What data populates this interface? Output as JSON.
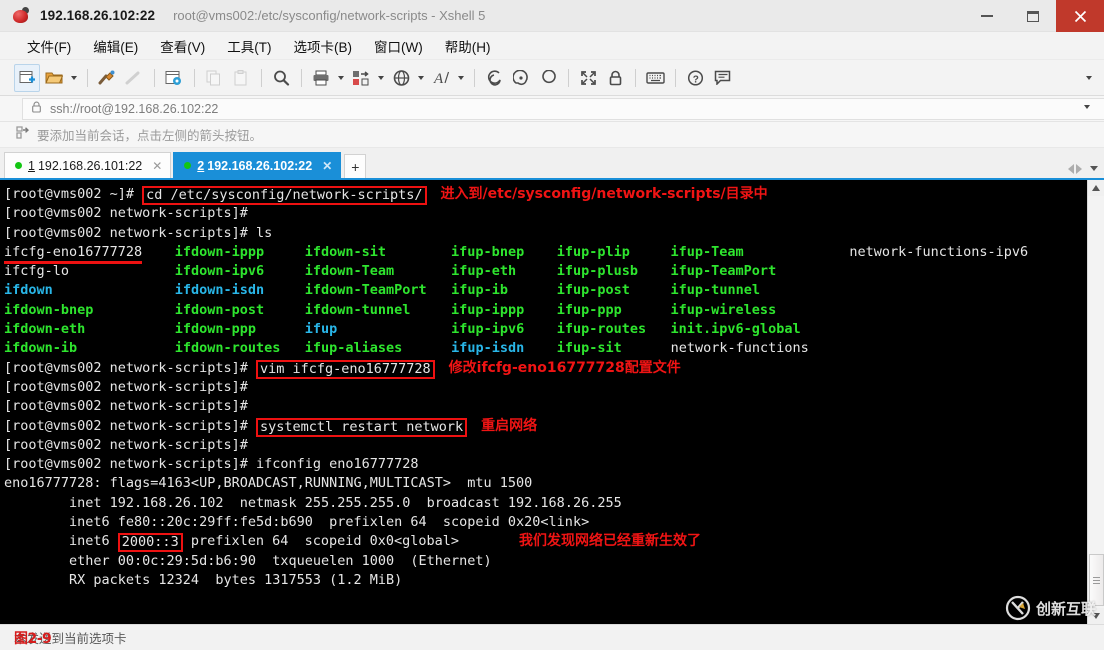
{
  "window": {
    "address_title": "192.168.26.102:22",
    "subtitle": "root@vms002:/etc/sysconfig/network-scripts - Xshell 5",
    "app_icon": "xshell-logo-icon",
    "controls": {
      "minimize": "minimize-button",
      "maximize": "maximize-button",
      "close": "close-button"
    }
  },
  "menubar": {
    "items": [
      {
        "label": "文件(F)",
        "name": "menu-file"
      },
      {
        "label": "编辑(E)",
        "name": "menu-edit"
      },
      {
        "label": "查看(V)",
        "name": "menu-view"
      },
      {
        "label": "工具(T)",
        "name": "menu-tools"
      },
      {
        "label": "选项卡(B)",
        "name": "menu-tab"
      },
      {
        "label": "窗口(W)",
        "name": "menu-window"
      },
      {
        "label": "帮助(H)",
        "name": "menu-help"
      }
    ]
  },
  "toolbar": {
    "buttons": [
      "new-session-icon",
      "open-folder-icon",
      "folder-dropdown-caret",
      "connect-icon",
      "disconnect-icon",
      "session-properties-icon",
      "copy-icon",
      "paste-icon",
      "find-icon",
      "print-icon",
      "print-dropdown-caret",
      "transfer-file-icon",
      "transfer-dropdown-caret",
      "web-browser-icon",
      "web-dropdown-caret",
      "font-icon",
      "font-dropdown-caret",
      "ftp-icon",
      "tunnel-icon",
      "compose-icon",
      "fullscreen-icon",
      "lock-icon",
      "keyboard-icon",
      "help-icon",
      "feedback-icon"
    ],
    "overflow": "toolbar-overflow-caret"
  },
  "addressbar": {
    "lock_icon": "lock-icon",
    "value": "ssh://root@192.168.26.102:22",
    "placeholder": "ssh://",
    "dropdown": "address-dropdown-caret"
  },
  "hintbar": {
    "icon": "add-session-arrow-icon",
    "text": "要添加当前会话，点击左侧的箭头按钮。"
  },
  "tabs": {
    "items": [
      {
        "num": "1",
        "label": "192.168.26.101:22",
        "active": false,
        "status": "connected"
      },
      {
        "num": "2",
        "label": "192.168.26.102:22",
        "active": true,
        "status": "connected"
      }
    ],
    "add_label": "+",
    "nav": {
      "prev": "tab-prev-arrow",
      "next": "tab-next-arrow",
      "list": "tab-list-caret"
    }
  },
  "terminal": {
    "prompt_home": "[root@vms002 ~]# ",
    "prompt_dir": "[root@vms002 network-scripts]# ",
    "cmd_cd": "cd /etc/sysconfig/network-scripts/",
    "cmd_ls": "ls",
    "cmd_vim": "vim ifcfg-eno16777728",
    "cmd_systemctl": "systemctl restart network",
    "cmd_ifconfig": "ifconfig eno16777728",
    "ls_rows": [
      [
        {
          "t": "ifcfg-eno16777728",
          "c": "wht"
        },
        {
          "t": "ifdown-ippp",
          "c": "grn"
        },
        {
          "t": "ifdown-sit",
          "c": "grn"
        },
        {
          "t": "ifup-bnep",
          "c": "grn"
        },
        {
          "t": "ifup-plip",
          "c": "grn"
        },
        {
          "t": "ifup-Team",
          "c": "grn"
        },
        {
          "t": "network-functions-ipv6",
          "c": "wht"
        }
      ],
      [
        {
          "t": "ifcfg-lo",
          "c": "wht"
        },
        {
          "t": "ifdown-ipv6",
          "c": "grn"
        },
        {
          "t": "ifdown-Team",
          "c": "grn"
        },
        {
          "t": "ifup-eth",
          "c": "grn"
        },
        {
          "t": "ifup-plusb",
          "c": "grn"
        },
        {
          "t": "ifup-TeamPort",
          "c": "grn"
        },
        {
          "t": "",
          "c": "wht"
        }
      ],
      [
        {
          "t": "ifdown",
          "c": "cyn"
        },
        {
          "t": "ifdown-isdn",
          "c": "cyn"
        },
        {
          "t": "ifdown-TeamPort",
          "c": "grn"
        },
        {
          "t": "ifup-ib",
          "c": "grn"
        },
        {
          "t": "ifup-post",
          "c": "grn"
        },
        {
          "t": "ifup-tunnel",
          "c": "grn"
        },
        {
          "t": "",
          "c": "wht"
        }
      ],
      [
        {
          "t": "ifdown-bnep",
          "c": "grn"
        },
        {
          "t": "ifdown-post",
          "c": "grn"
        },
        {
          "t": "ifdown-tunnel",
          "c": "grn"
        },
        {
          "t": "ifup-ippp",
          "c": "grn"
        },
        {
          "t": "ifup-ppp",
          "c": "grn"
        },
        {
          "t": "ifup-wireless",
          "c": "grn"
        },
        {
          "t": "",
          "c": "wht"
        }
      ],
      [
        {
          "t": "ifdown-eth",
          "c": "grn"
        },
        {
          "t": "ifdown-ppp",
          "c": "grn"
        },
        {
          "t": "ifup",
          "c": "cyn"
        },
        {
          "t": "ifup-ipv6",
          "c": "grn"
        },
        {
          "t": "ifup-routes",
          "c": "grn"
        },
        {
          "t": "init.ipv6-global",
          "c": "grn"
        },
        {
          "t": "",
          "c": "wht"
        }
      ],
      [
        {
          "t": "ifdown-ib",
          "c": "grn"
        },
        {
          "t": "ifdown-routes",
          "c": "grn"
        },
        {
          "t": "ifup-aliases",
          "c": "grn"
        },
        {
          "t": "ifup-isdn",
          "c": "cyn"
        },
        {
          "t": "ifup-sit",
          "c": "grn"
        },
        {
          "t": "network-functions",
          "c": "wht"
        },
        {
          "t": "",
          "c": "wht"
        }
      ]
    ],
    "ifconfig": {
      "l1": "eno16777728: flags=4163<UP,BROADCAST,RUNNING,MULTICAST>  mtu 1500",
      "l2": "        inet 192.168.26.102  netmask 255.255.255.0  broadcast 192.168.26.255",
      "l3": "        inet6 fe80::20c:29ff:fe5d:b690  prefixlen 64  scopeid 0x20<link>",
      "l4_pre": "        inet6 ",
      "l4_boxed": "2000::3",
      "l4_post": " prefixlen 64  scopeid 0x0<global>",
      "l5": "        ether 00:0c:29:5d:b6:90  txqueuelen 1000  (Ethernet)",
      "l6": "        RX packets 12324  bytes 1317553 (1.2 MiB)"
    },
    "annotations": {
      "a1": "进入到/etc/sysconfig/network-scripts/目录中",
      "a2": "修改ifcfg-eno16777728配置文件",
      "a3": "重启网络",
      "a4": "我们发现网络已经重新生效了"
    },
    "colors": {
      "background": "#000000",
      "foreground": "#d8d8d8",
      "green": "#2ee52e",
      "cyan": "#29b6e8",
      "highlight_red": "#ee1111",
      "annotation_red": "#f01414"
    }
  },
  "scrollbar": {
    "up": "scroll-up-arrow",
    "down": "scroll-down-arrow",
    "thumb": "scroll-thumb"
  },
  "statusbar": {
    "text": "本发送到当前选项卡",
    "figure_label": "图2-9",
    "watermark": "创新互联"
  }
}
